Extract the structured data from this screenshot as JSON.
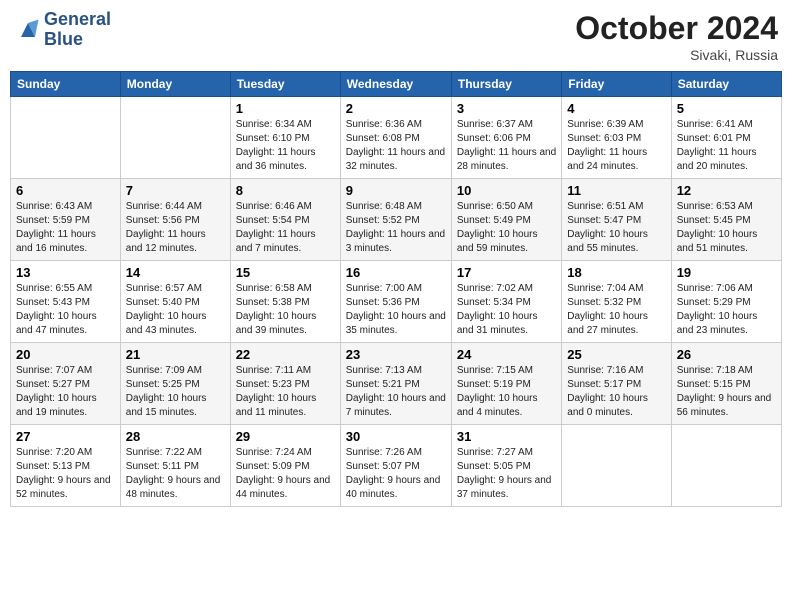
{
  "header": {
    "logo_line1": "General",
    "logo_line2": "Blue",
    "month": "October 2024",
    "location": "Sivaki, Russia"
  },
  "columns": [
    "Sunday",
    "Monday",
    "Tuesday",
    "Wednesday",
    "Thursday",
    "Friday",
    "Saturday"
  ],
  "weeks": [
    [
      {
        "day": "",
        "detail": ""
      },
      {
        "day": "",
        "detail": ""
      },
      {
        "day": "1",
        "detail": "Sunrise: 6:34 AM\nSunset: 6:10 PM\nDaylight: 11 hours and 36 minutes."
      },
      {
        "day": "2",
        "detail": "Sunrise: 6:36 AM\nSunset: 6:08 PM\nDaylight: 11 hours and 32 minutes."
      },
      {
        "day": "3",
        "detail": "Sunrise: 6:37 AM\nSunset: 6:06 PM\nDaylight: 11 hours and 28 minutes."
      },
      {
        "day": "4",
        "detail": "Sunrise: 6:39 AM\nSunset: 6:03 PM\nDaylight: 11 hours and 24 minutes."
      },
      {
        "day": "5",
        "detail": "Sunrise: 6:41 AM\nSunset: 6:01 PM\nDaylight: 11 hours and 20 minutes."
      }
    ],
    [
      {
        "day": "6",
        "detail": "Sunrise: 6:43 AM\nSunset: 5:59 PM\nDaylight: 11 hours and 16 minutes."
      },
      {
        "day": "7",
        "detail": "Sunrise: 6:44 AM\nSunset: 5:56 PM\nDaylight: 11 hours and 12 minutes."
      },
      {
        "day": "8",
        "detail": "Sunrise: 6:46 AM\nSunset: 5:54 PM\nDaylight: 11 hours and 7 minutes."
      },
      {
        "day": "9",
        "detail": "Sunrise: 6:48 AM\nSunset: 5:52 PM\nDaylight: 11 hours and 3 minutes."
      },
      {
        "day": "10",
        "detail": "Sunrise: 6:50 AM\nSunset: 5:49 PM\nDaylight: 10 hours and 59 minutes."
      },
      {
        "day": "11",
        "detail": "Sunrise: 6:51 AM\nSunset: 5:47 PM\nDaylight: 10 hours and 55 minutes."
      },
      {
        "day": "12",
        "detail": "Sunrise: 6:53 AM\nSunset: 5:45 PM\nDaylight: 10 hours and 51 minutes."
      }
    ],
    [
      {
        "day": "13",
        "detail": "Sunrise: 6:55 AM\nSunset: 5:43 PM\nDaylight: 10 hours and 47 minutes."
      },
      {
        "day": "14",
        "detail": "Sunrise: 6:57 AM\nSunset: 5:40 PM\nDaylight: 10 hours and 43 minutes."
      },
      {
        "day": "15",
        "detail": "Sunrise: 6:58 AM\nSunset: 5:38 PM\nDaylight: 10 hours and 39 minutes."
      },
      {
        "day": "16",
        "detail": "Sunrise: 7:00 AM\nSunset: 5:36 PM\nDaylight: 10 hours and 35 minutes."
      },
      {
        "day": "17",
        "detail": "Sunrise: 7:02 AM\nSunset: 5:34 PM\nDaylight: 10 hours and 31 minutes."
      },
      {
        "day": "18",
        "detail": "Sunrise: 7:04 AM\nSunset: 5:32 PM\nDaylight: 10 hours and 27 minutes."
      },
      {
        "day": "19",
        "detail": "Sunrise: 7:06 AM\nSunset: 5:29 PM\nDaylight: 10 hours and 23 minutes."
      }
    ],
    [
      {
        "day": "20",
        "detail": "Sunrise: 7:07 AM\nSunset: 5:27 PM\nDaylight: 10 hours and 19 minutes."
      },
      {
        "day": "21",
        "detail": "Sunrise: 7:09 AM\nSunset: 5:25 PM\nDaylight: 10 hours and 15 minutes."
      },
      {
        "day": "22",
        "detail": "Sunrise: 7:11 AM\nSunset: 5:23 PM\nDaylight: 10 hours and 11 minutes."
      },
      {
        "day": "23",
        "detail": "Sunrise: 7:13 AM\nSunset: 5:21 PM\nDaylight: 10 hours and 7 minutes."
      },
      {
        "day": "24",
        "detail": "Sunrise: 7:15 AM\nSunset: 5:19 PM\nDaylight: 10 hours and 4 minutes."
      },
      {
        "day": "25",
        "detail": "Sunrise: 7:16 AM\nSunset: 5:17 PM\nDaylight: 10 hours and 0 minutes."
      },
      {
        "day": "26",
        "detail": "Sunrise: 7:18 AM\nSunset: 5:15 PM\nDaylight: 9 hours and 56 minutes."
      }
    ],
    [
      {
        "day": "27",
        "detail": "Sunrise: 7:20 AM\nSunset: 5:13 PM\nDaylight: 9 hours and 52 minutes."
      },
      {
        "day": "28",
        "detail": "Sunrise: 7:22 AM\nSunset: 5:11 PM\nDaylight: 9 hours and 48 minutes."
      },
      {
        "day": "29",
        "detail": "Sunrise: 7:24 AM\nSunset: 5:09 PM\nDaylight: 9 hours and 44 minutes."
      },
      {
        "day": "30",
        "detail": "Sunrise: 7:26 AM\nSunset: 5:07 PM\nDaylight: 9 hours and 40 minutes."
      },
      {
        "day": "31",
        "detail": "Sunrise: 7:27 AM\nSunset: 5:05 PM\nDaylight: 9 hours and 37 minutes."
      },
      {
        "day": "",
        "detail": ""
      },
      {
        "day": "",
        "detail": ""
      }
    ]
  ]
}
